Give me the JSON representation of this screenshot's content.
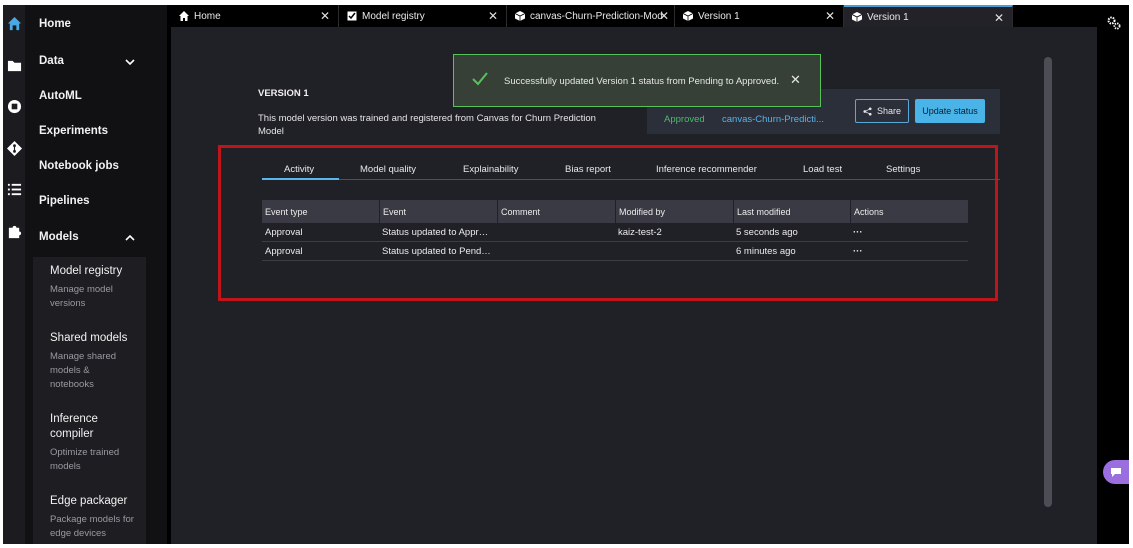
{
  "rail": {
    "icons": [
      "home-icon",
      "folder-icon",
      "circle-stop-icon",
      "git-icon",
      "list-icon",
      "puzzle-icon"
    ]
  },
  "sidebar": {
    "items": [
      {
        "label": "Home"
      },
      {
        "label": "Data"
      },
      {
        "label": "AutoML"
      },
      {
        "label": "Experiments"
      },
      {
        "label": "Notebook jobs"
      },
      {
        "label": "Pipelines"
      },
      {
        "label": "Models"
      }
    ],
    "submenu": [
      {
        "title": "Model registry",
        "desc": "Manage model versions"
      },
      {
        "title": "Shared models",
        "desc": "Manage shared models & notebooks"
      },
      {
        "title": "Inference compiler",
        "desc": "Optimize trained models"
      },
      {
        "title": "Edge packager",
        "desc": "Package models for edge devices"
      }
    ]
  },
  "tabs": [
    {
      "label": "Home"
    },
    {
      "label": "Model registry"
    },
    {
      "label": "canvas-Churn-Prediction-Mod"
    },
    {
      "label": "Version 1"
    },
    {
      "label": "Version 1"
    }
  ],
  "page": {
    "title": "VERSION 1",
    "description": "This model version was trained and registered from Canvas for Churn Prediction Model"
  },
  "status_panel": {
    "status": "Approved",
    "link": "canvas-Churn-Predicti...",
    "share_label": "Share",
    "update_label": "Update status"
  },
  "toast": {
    "message": "Successfully updated Version 1 status from Pending to Approved."
  },
  "detail_tabs": [
    "Activity",
    "Model quality",
    "Explainability",
    "Bias report",
    "Inference recommender",
    "Load test",
    "Settings"
  ],
  "table": {
    "headers": [
      "Event type",
      "Event",
      "Comment",
      "Modified by",
      "Last modified",
      "Actions"
    ],
    "rows": [
      [
        "Approval",
        "Status updated to Appr…",
        "",
        "kaiz-test-2",
        "5 seconds ago",
        "···"
      ],
      [
        "Approval",
        "Status updated to Pend…",
        "",
        "",
        "6 minutes ago",
        "···"
      ]
    ]
  },
  "colors": {
    "accent": "#4ab3e8",
    "approved": "#4fb86a",
    "highlight": "#c0141b",
    "toast_border": "#57c25a"
  }
}
